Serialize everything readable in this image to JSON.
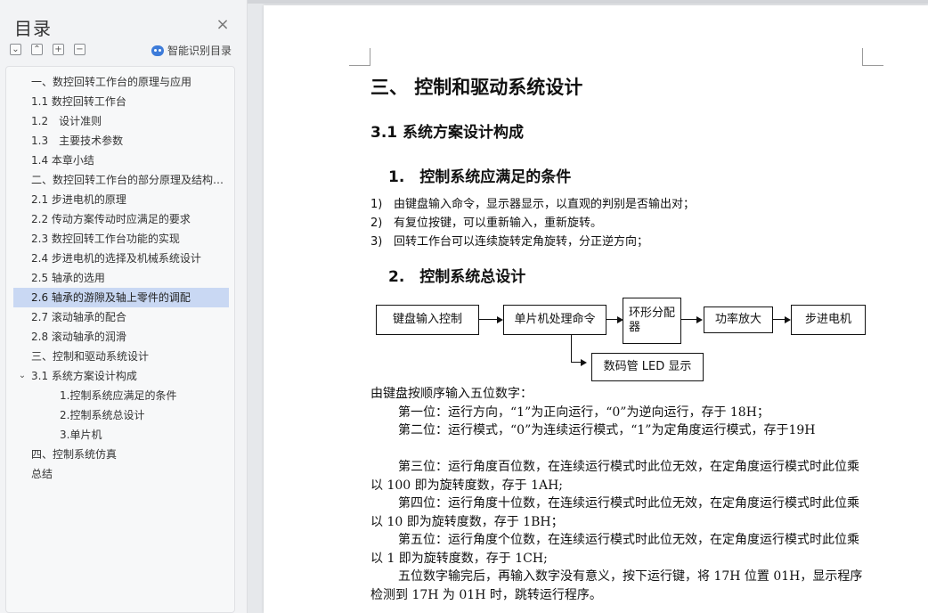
{
  "toc": {
    "title": "目录",
    "close_icon": "×",
    "toolbar": {
      "expand_icon": "⌄",
      "collapse_icon": "⌃",
      "add_icon": "+",
      "remove_icon": "−",
      "smart_label": "智能识别目录"
    },
    "items": [
      {
        "label": "一、数控回转工作台的原理与应用",
        "level": 1
      },
      {
        "label": "1.1 数控回转工作台",
        "level": 1
      },
      {
        "label": "1.2　设计准则",
        "level": 1
      },
      {
        "label": "1.3　主要技术参数",
        "level": 1
      },
      {
        "label": "1.4 本章小结",
        "level": 1
      },
      {
        "label": "二、数控回转工作台的部分原理及结构设计",
        "level": 1
      },
      {
        "label": "2.1 步进电机的原理",
        "level": 1
      },
      {
        "label": "2.2 传动方案传动时应满足的要求",
        "level": 1
      },
      {
        "label": "2.3 数控回转工作台功能的实现",
        "level": 1
      },
      {
        "label": "2.4 步进电机的选择及机械系统设计",
        "level": 1
      },
      {
        "label": "2.5 轴承的选用",
        "level": 1
      },
      {
        "label": "2.6 轴承的游隙及轴上零件的调配",
        "level": 1,
        "active": true
      },
      {
        "label": "2.7 滚动轴承的配合",
        "level": 1
      },
      {
        "label": "2.8 滚动轴承的润滑",
        "level": 1
      },
      {
        "label": "三、控制和驱动系统设计",
        "level": 1
      },
      {
        "label": "3.1 系统方案设计构成",
        "level": 1,
        "expanded": true
      },
      {
        "label": "1.控制系统应满足的条件",
        "level": 2
      },
      {
        "label": "2.控制系统总设计",
        "level": 2
      },
      {
        "label": "3.单片机",
        "level": 2
      },
      {
        "label": "四、控制系统仿真",
        "level": 1
      },
      {
        "label": "总结",
        "level": 1
      }
    ],
    "active_color": "#c9d8f3"
  },
  "doc": {
    "h1": "三、 控制和驱动系统设计",
    "h2": "3.1  系统方案设计构成",
    "section1": {
      "heading": "1.　控制系统应满足的条件",
      "items": [
        {
          "num": "1)",
          "text": "由键盘输入命令，显示器显示，以直观的判别是否输出对；"
        },
        {
          "num": "2)",
          "text": "有复位按键，可以重新输入，重新旋转。"
        },
        {
          "num": "3)",
          "text": "回转工作台可以连续旋转定角旋转，分正逆方向；"
        }
      ]
    },
    "section2": {
      "heading": "2.　控制系统总设计"
    },
    "diagram": {
      "keyboard": "键盘输入控制",
      "mcu": "单片机处理命令",
      "ring_dist": "环形分配器",
      "power_amp": "功率放大",
      "stepper": "步进电机",
      "led_display": "数码管 LED 显示"
    },
    "paragraphs": [
      {
        "text": "由键盘按顺序输入五位数字：",
        "indent": false
      },
      {
        "text": "第一位：运行方向，“1”为正向运行，“0”为逆向运行，存于 18H；",
        "indent": true
      },
      {
        "text": "第二位：运行模式，“0”为连续运行模式，“1”为定角度运行模式，存于19H",
        "indent": true
      },
      {
        "text": "第三位：运行角度百位数，在连续运行模式时此位无效，在定角度运行模式时此位乘以 100 即为旋转度数，存于 1AH;",
        "indent": true
      },
      {
        "text": "第四位：运行角度十位数，在连续运行模式时此位无效，在定角度运行模式时此位乘以 10 即为旋转度数，存于 1BH；",
        "indent": true
      },
      {
        "text": "第五位：运行角度个位数，在连续运行模式时此位无效，在定角度运行模式时此位乘以 1 即为旋转度数，存于 1CH;",
        "indent": true
      },
      {
        "text": "五位数字输完后，再输入数字没有意义，按下运行键，将 17H 位置 01H，显示程序检测到 17H 为 01H 时，跳转运行程序。",
        "indent": true
      }
    ]
  }
}
